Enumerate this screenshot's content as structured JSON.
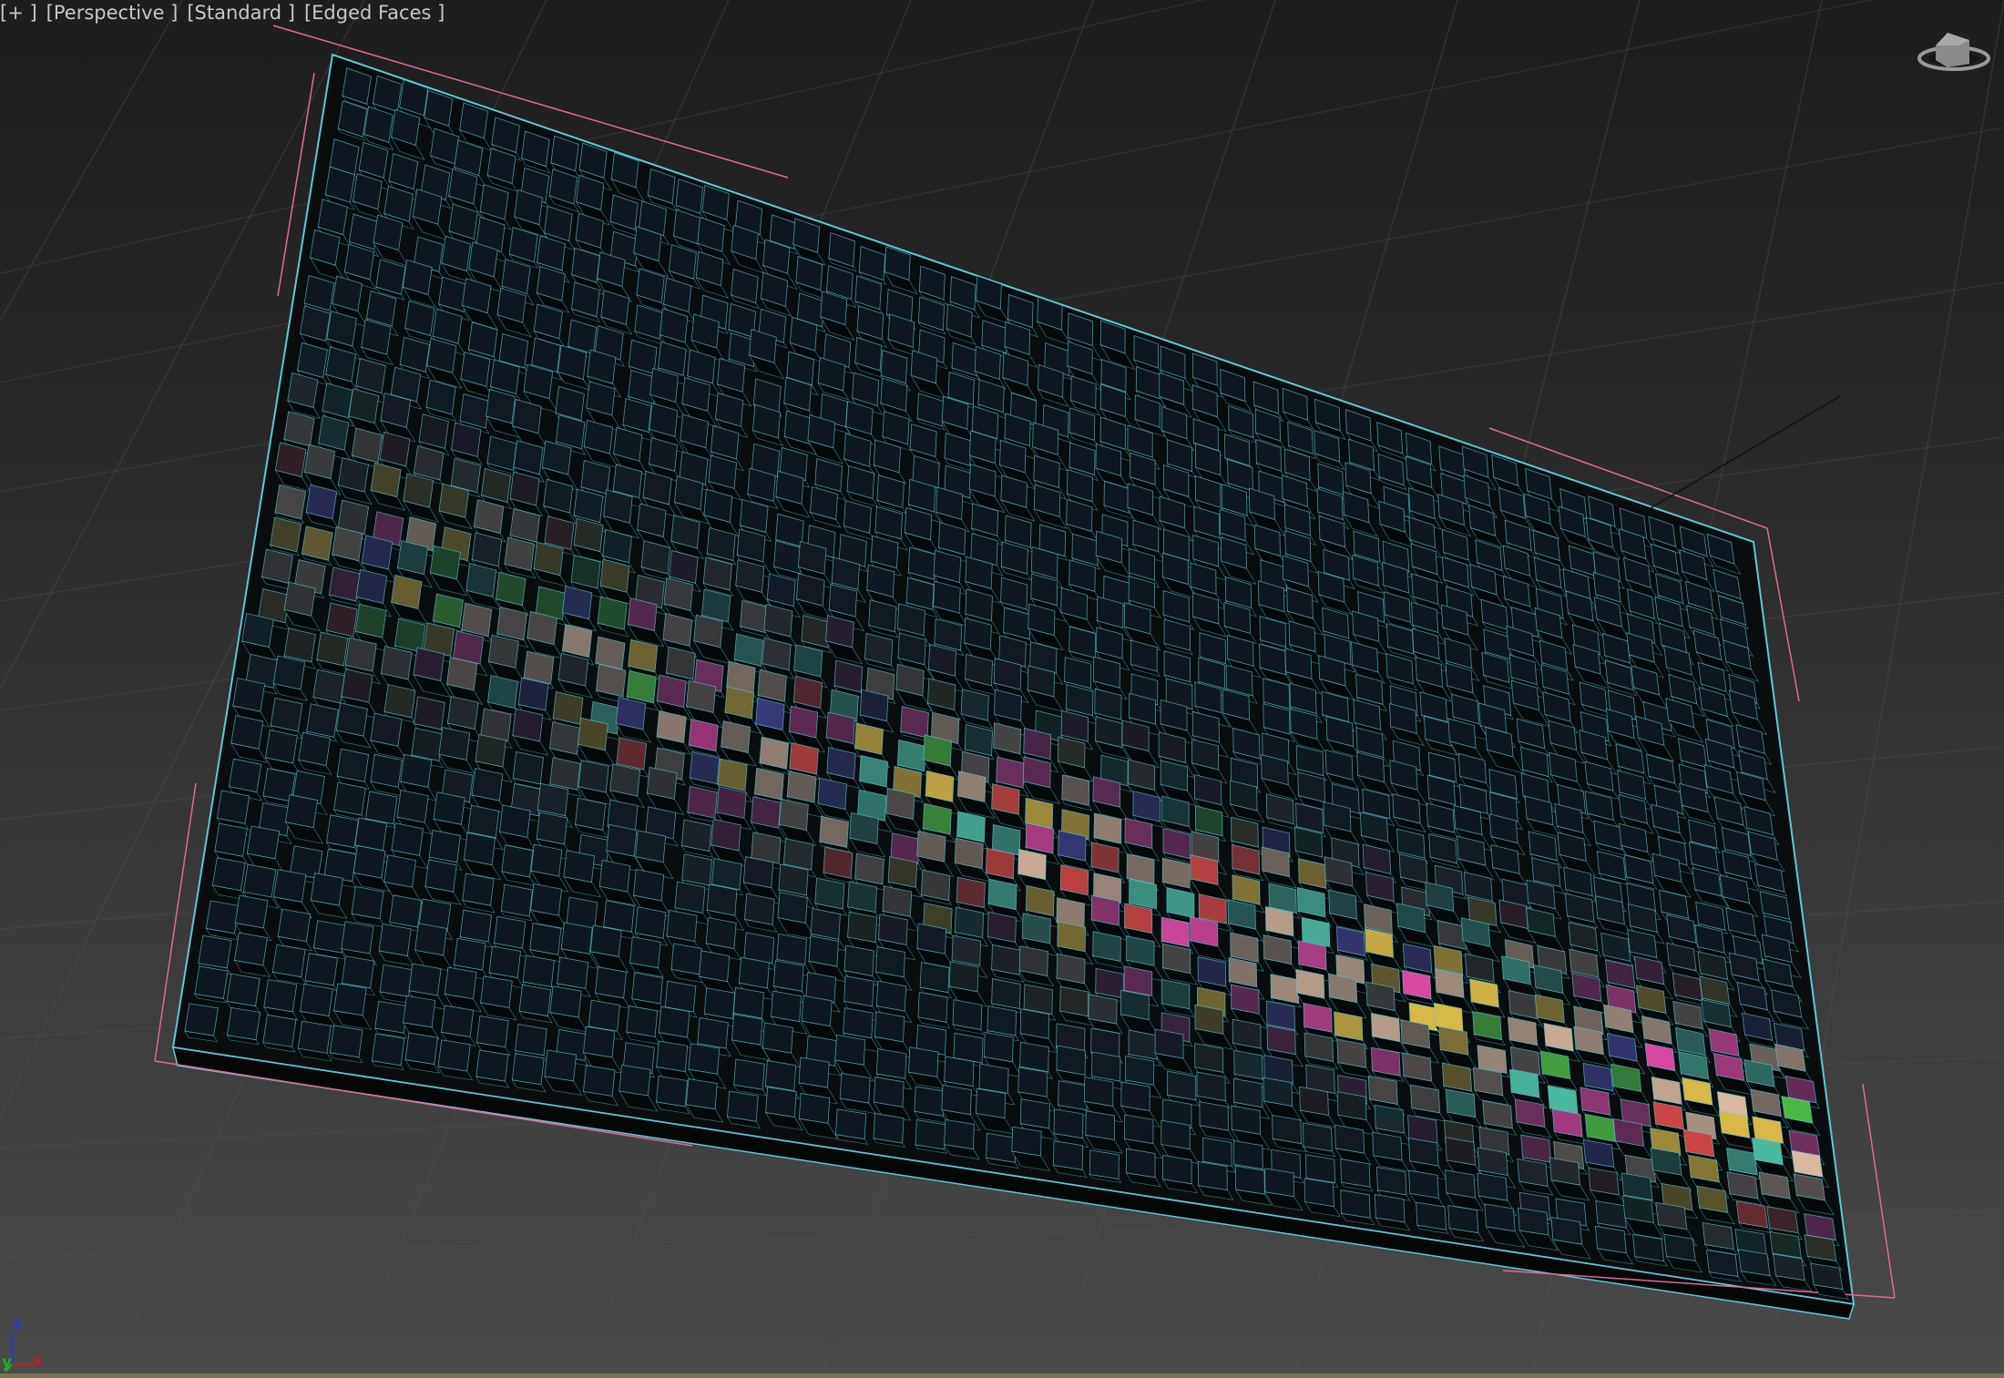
{
  "viewport": {
    "labels": {
      "menu": "[+ ]",
      "view": "[Perspective ]",
      "shading": "[Standard ]",
      "display": "[Edged Faces ]"
    },
    "axis_tripod": {
      "z": "z",
      "y": "y",
      "x": "x"
    },
    "colors": {
      "wire": "#5fc8d8",
      "bbox": "#e06a9a",
      "bright_cube": "#d8b8a0",
      "dark_cube": "#0f1a22"
    },
    "icons": {
      "viewcube": "viewcube-icon",
      "axis": "axis-tripod-icon"
    }
  }
}
